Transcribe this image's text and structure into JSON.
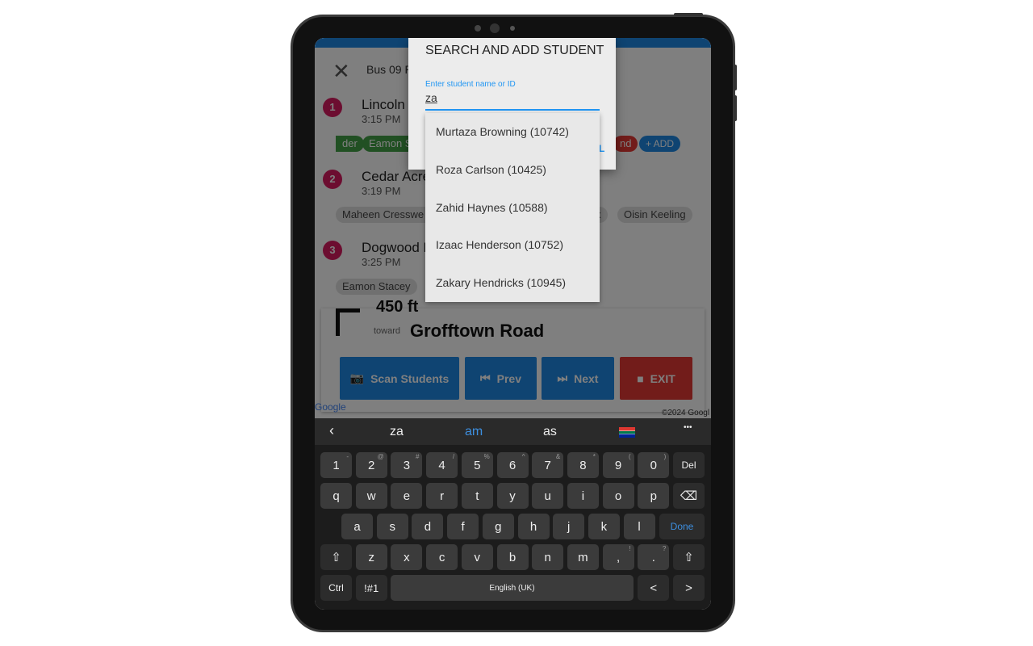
{
  "app": {
    "close_icon": "close-icon",
    "title": "Bus 09 P",
    "stops": [
      {
        "num": "1",
        "name": "Lincoln",
        "time": "3:15 PM"
      },
      {
        "num": "2",
        "name": "Cedar Acre",
        "time": "3:19 PM"
      },
      {
        "num": "3",
        "name": "Dogwood L",
        "time": "3:25 PM"
      }
    ],
    "stop1_chips": [
      "der",
      "Eamon S",
      "nd"
    ],
    "add_label": "+ ADD",
    "stop2_chips": [
      "Maheen Cresswe",
      "x",
      "Oisin Keeling"
    ],
    "stop3_chips": [
      "Eamon Stacey"
    ],
    "nav": {
      "distance": "450 ft",
      "toward": "toward",
      "road": "Grofftown Road"
    },
    "buttons": {
      "scan": "Scan Students",
      "prev": "Prev",
      "next": "Next",
      "exit": "EXIT"
    },
    "map_copyright": "©2024 Googl",
    "map_logo": "Google",
    "colors": {
      "primary": "#1e88e5",
      "danger": "#e53935",
      "stop_badge": "#d81b60",
      "chip_green": "#43a047"
    }
  },
  "dialog": {
    "title": "SEARCH AND ADD STUDENT",
    "input_label": "Enter student name or ID",
    "input_value": "za",
    "cancel_partial": "L",
    "suggestions": [
      "Murtaza Browning (10742)",
      "Roza Carlson (10425)",
      "Zahid Haynes (10588)",
      "Izaac Henderson (10752)",
      "Zakary Hendricks (10945)"
    ]
  },
  "keyboard": {
    "suggestions": [
      "za",
      "am",
      "as"
    ],
    "flag": "south-africa-flag",
    "more": "•••",
    "row1": [
      [
        "1",
        "-"
      ],
      [
        "2",
        "@"
      ],
      [
        "3",
        "#"
      ],
      [
        "4",
        "/"
      ],
      [
        "5",
        "%"
      ],
      [
        "6",
        "^"
      ],
      [
        "7",
        "&"
      ],
      [
        "8",
        "*"
      ],
      [
        "9",
        "("
      ],
      [
        "0",
        ")"
      ],
      [
        "Del",
        ""
      ]
    ],
    "row2": [
      "q",
      "w",
      "e",
      "r",
      "t",
      "y",
      "u",
      "i",
      "o",
      "p"
    ],
    "row3": [
      "a",
      "s",
      "d",
      "f",
      "g",
      "h",
      "j",
      "k",
      "l"
    ],
    "done": "Done",
    "row4": [
      [
        "z",
        ""
      ],
      [
        "x",
        ""
      ],
      [
        "c",
        ""
      ],
      [
        "v",
        ""
      ],
      [
        "b",
        ""
      ],
      [
        "n",
        ""
      ],
      [
        "m",
        ""
      ],
      [
        ",",
        "!"
      ],
      [
        ".",
        "?"
      ]
    ],
    "ctrl": "Ctrl",
    "sym": "!#1",
    "space": "English (UK)",
    "left": "<",
    "right": ">"
  }
}
